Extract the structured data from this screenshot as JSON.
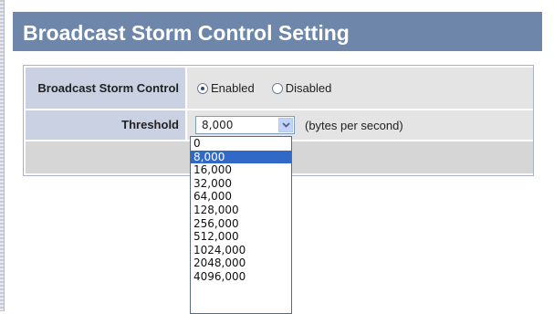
{
  "page": {
    "title": "Broadcast Storm Control Setting"
  },
  "form": {
    "storm_control_label": "Broadcast Storm Control",
    "radio_enabled_label": "Enabled",
    "radio_disabled_label": "Disabled",
    "selected_radio": "Enabled",
    "threshold_label": "Threshold",
    "threshold_value": "8,000",
    "threshold_units": "(bytes per second)"
  },
  "dropdown": {
    "options": [
      "0",
      "8,000",
      "16,000",
      "32,000",
      "64,000",
      "128,000",
      "256,000",
      "512,000",
      "1024,000",
      "2048,000",
      "4096,000"
    ],
    "highlighted_option": "8,000"
  },
  "colors": {
    "title_bar": "#6d86aa",
    "label_cell": "#c9d1e2",
    "value_cell": "#e4e4e4",
    "highlight": "#3169c6"
  },
  "icons": {
    "select_arrow": "chevron-down-icon"
  }
}
